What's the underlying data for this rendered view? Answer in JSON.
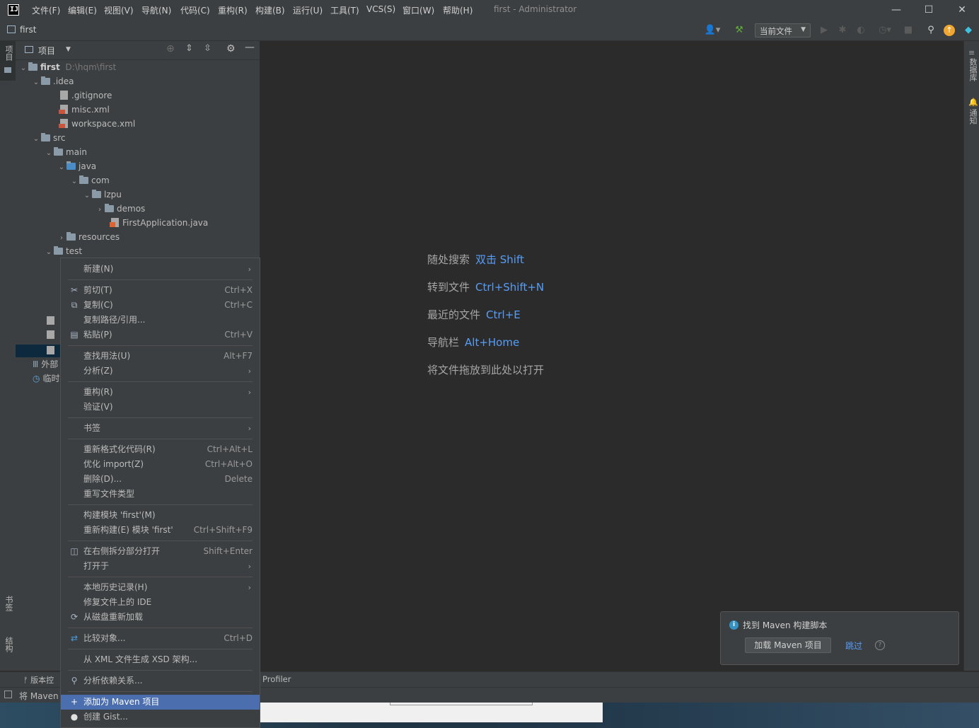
{
  "app": {
    "logo_text": "IJ",
    "menu": [
      "文件(F)",
      "编辑(E)",
      "视图(V)",
      "导航(N)",
      "代码(C)",
      "重构(R)",
      "构建(B)",
      "运行(U)",
      "工具(T)",
      "VCS(S)",
      "窗口(W)",
      "帮助(H)"
    ],
    "window_title": "first - Administrator",
    "window_buttons": {
      "minimize": "—",
      "maximize": "☐",
      "close": "✕"
    }
  },
  "navbar": {
    "breadcrumb": "first",
    "run_config": "当前文件",
    "icons": [
      "user-icon",
      "build-hammer-icon",
      "run-icon",
      "debug-icon",
      "coverage-icon",
      "profile-icon",
      "stop-icon",
      "search-icon",
      "update-icon",
      "plugin-icon"
    ]
  },
  "left_stripe": {
    "project": "项目",
    "bookmarks": "书签",
    "structure": "结构"
  },
  "right_stripe": {
    "database": "数据库",
    "notifications": "通知"
  },
  "project_panel": {
    "title": "项目",
    "tree": [
      {
        "label": "first",
        "detail": "D:\\hqm\\first",
        "type": "module",
        "expanded": true
      },
      {
        "label": ".idea",
        "type": "folder",
        "expanded": true
      },
      {
        "label": ".gitignore",
        "type": "file"
      },
      {
        "label": "misc.xml",
        "type": "xml"
      },
      {
        "label": "workspace.xml",
        "type": "xml"
      },
      {
        "label": "src",
        "type": "folder",
        "expanded": true
      },
      {
        "label": "main",
        "type": "folder",
        "expanded": true
      },
      {
        "label": "java",
        "type": "folder",
        "expanded": true
      },
      {
        "label": "com",
        "type": "folder",
        "expanded": true
      },
      {
        "label": "lzpu",
        "type": "folder",
        "expanded": true
      },
      {
        "label": "demos",
        "type": "folder",
        "expanded": false
      },
      {
        "label": "FirstApplication.java",
        "type": "java"
      },
      {
        "label": "resources",
        "type": "folder",
        "expanded": false
      },
      {
        "label": "test",
        "type": "folder",
        "expanded": true
      }
    ],
    "extra_rows": [
      "外部",
      "临时"
    ]
  },
  "editor": {
    "hints": [
      {
        "label": "随处搜索",
        "key": "双击 Shift"
      },
      {
        "label": "转到文件",
        "key": "Ctrl+Shift+N"
      },
      {
        "label": "最近的文件",
        "key": "Ctrl+E"
      },
      {
        "label": "导航栏",
        "key": "Alt+Home"
      },
      {
        "label": "将文件拖放到此处以打开",
        "key": ""
      }
    ]
  },
  "context_menu": {
    "items": [
      {
        "label": "新建(N)",
        "arrow": true
      },
      {
        "label": "剪切(T)",
        "shortcut": "Ctrl+X",
        "icon": "✂"
      },
      {
        "label": "复制(C)",
        "shortcut": "Ctrl+C",
        "icon": "⧉"
      },
      {
        "label": "复制路径/引用...",
        "shortcut": ""
      },
      {
        "label": "粘贴(P)",
        "shortcut": "Ctrl+V",
        "icon": "▤"
      },
      {
        "label": "查找用法(U)",
        "shortcut": "Alt+F7"
      },
      {
        "label": "分析(Z)",
        "arrow": true
      },
      {
        "label": "重构(R)",
        "arrow": true
      },
      {
        "label": "验证(V)"
      },
      {
        "label": "书签",
        "arrow": true
      },
      {
        "label": "重新格式化代码(R)",
        "shortcut": "Ctrl+Alt+L"
      },
      {
        "label": "优化 import(Z)",
        "shortcut": "Ctrl+Alt+O"
      },
      {
        "label": "删除(D)...",
        "shortcut": "Delete"
      },
      {
        "label": "重写文件类型"
      },
      {
        "label": "构建模块 'first'(M)"
      },
      {
        "label": "重新构建(E) 模块 'first'",
        "shortcut": "Ctrl+Shift+F9"
      },
      {
        "label": "在右侧拆分部分打开",
        "shortcut": "Shift+Enter",
        "icon": "◫"
      },
      {
        "label": "打开于",
        "arrow": true
      },
      {
        "label": "本地历史记录(H)",
        "arrow": true
      },
      {
        "label": "修复文件上的 IDE"
      },
      {
        "label": "从磁盘重新加载",
        "icon": "⟳"
      },
      {
        "label": "比较对象...",
        "shortcut": "Ctrl+D",
        "icon": "⇄"
      },
      {
        "label": "从 XML 文件生成 XSD 架构..."
      },
      {
        "label": "分析依赖关系...",
        "icon": "⚲"
      },
      {
        "label": "添加为 Maven 项目",
        "icon": "+"
      },
      {
        "label": "创建 Gist...",
        "icon": "●"
      }
    ]
  },
  "bottom": {
    "toolwindow_left": "版本控",
    "profiler": "Profiler",
    "status_text": "将 Maven"
  },
  "notification": {
    "title": "找到 Maven 构建脚本",
    "action": "加载 Maven 项目",
    "skip": "跳过",
    "help": "?"
  }
}
